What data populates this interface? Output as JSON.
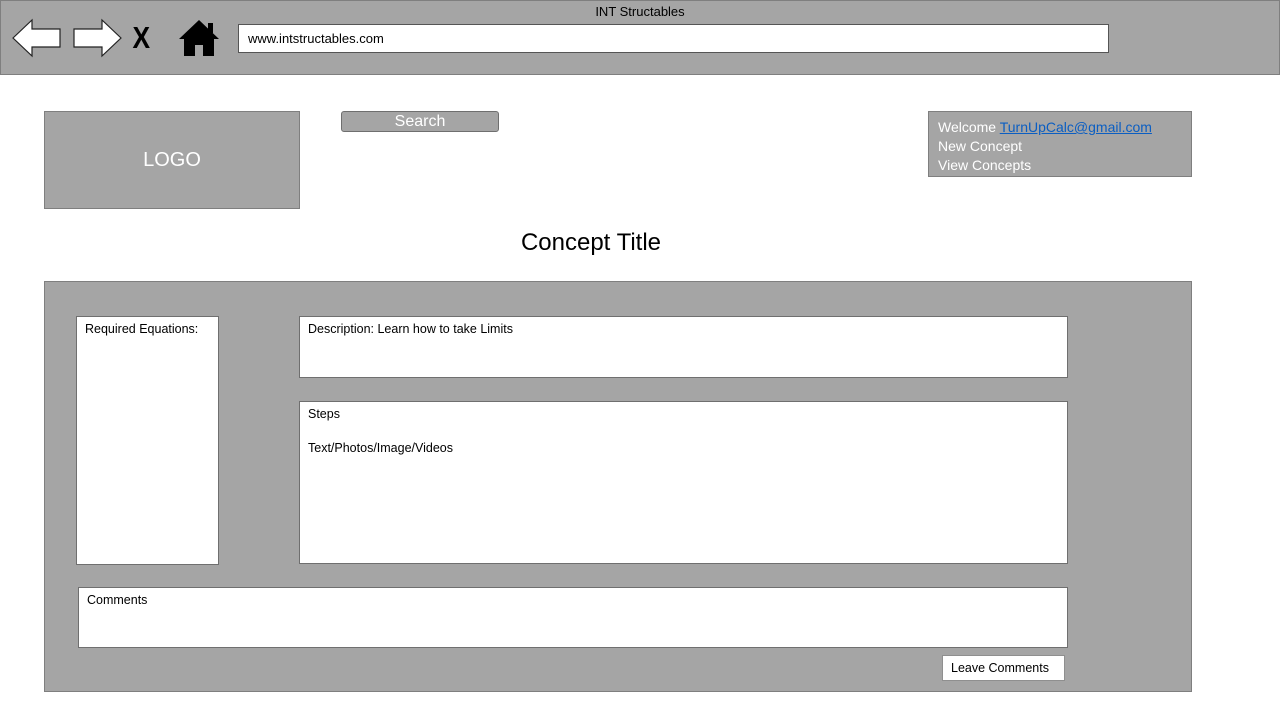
{
  "window": {
    "title": "INT Structables"
  },
  "toolbar": {
    "back_icon": "back-arrow-icon",
    "forward_icon": "forward-arrow-icon",
    "stop_label": "X",
    "home_icon": "home-icon",
    "url": "www.intstructables.com"
  },
  "header": {
    "logo_text": "LOGO",
    "search_label": "Search",
    "user_menu": {
      "welcome": "Welcome",
      "email": "TurnUpCalc@gmail.com",
      "items": [
        "New Concept",
        "View Concepts"
      ]
    }
  },
  "concept": {
    "title": "Concept Title",
    "equations_label": "Required Equations:",
    "description": "Description: Learn how to take Limits",
    "steps_label": "Steps",
    "steps_content": "Text/Photos/Image/Videos",
    "comments_label": "Comments",
    "leave_comments_label": "Leave Comments"
  },
  "colors": {
    "chrome": "#a5a5a5",
    "link": "#0b5ec2"
  }
}
